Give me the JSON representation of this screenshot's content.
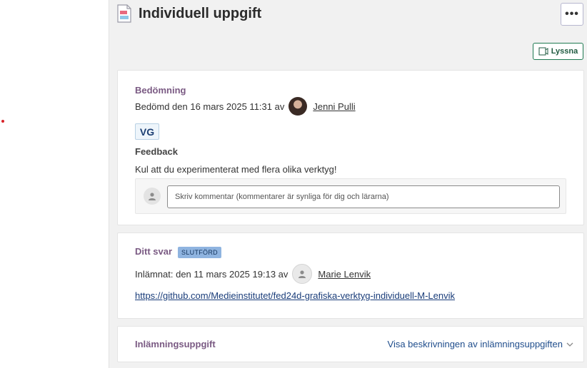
{
  "page": {
    "title": "Individuell uppgift",
    "more_label": "•••",
    "listen_label": "Lyssna"
  },
  "assessment": {
    "title": "Bedömning",
    "meta_prefix": "Bedömd den 16 mars 2025 11:31 av",
    "assessor": "Jenni Pulli",
    "grade": "VG",
    "feedback_title": "Feedback",
    "feedback_text": "Kul att du experimenterat med flera olika verktyg!",
    "comment_placeholder": "Skriv kommentar (kommentarer är synliga för dig och lärarna)"
  },
  "answer": {
    "title": "Ditt svar",
    "status_badge": "SLUTFÖRD",
    "meta_prefix": "Inlämnat: den 11 mars 2025 19:13 av",
    "submitter": "Marie Lenvik",
    "link": "https://github.com/Medieinstitutet/fed24d-grafiska-verktyg-individuell-M-Lenvik"
  },
  "task": {
    "title": "Inlämningsuppgift",
    "description_link": "Visa beskrivningen av inlämningsuppgiften"
  },
  "colors": {
    "section_title": "#7a5a83",
    "listen_border": "#1f7a52",
    "badge_bg": "#8fb4e0",
    "link": "#1a3d7a",
    "marker": "#d8232a"
  }
}
